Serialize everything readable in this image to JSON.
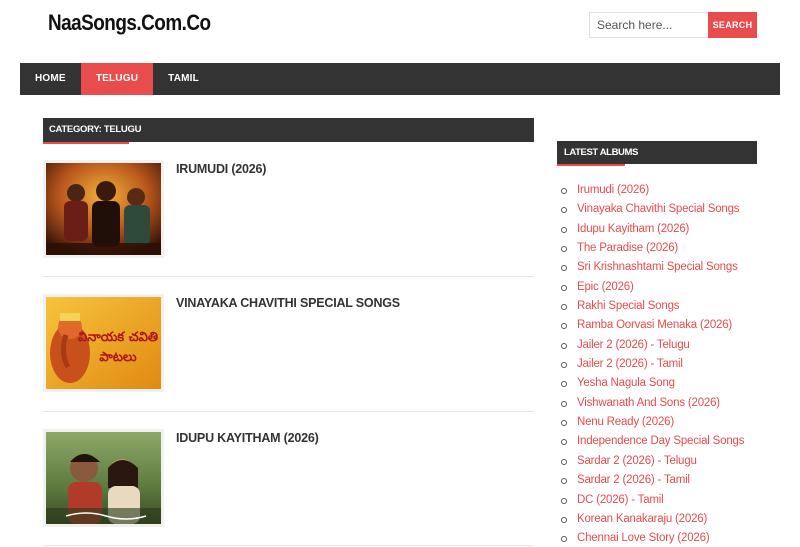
{
  "site": {
    "title": "NaaSongs.Com.Co"
  },
  "search": {
    "placeholder": "Search here...",
    "button_label": "SEARCH"
  },
  "nav": {
    "items": [
      {
        "label": "HOME",
        "active": false
      },
      {
        "label": "TELUGU",
        "active": true
      },
      {
        "label": "TAMIL",
        "active": false
      }
    ]
  },
  "category": {
    "header": "CATEGORY: TELUGU"
  },
  "posts": [
    {
      "title": "IRUMUDI (2026)",
      "thumb": "irumudi-poster"
    },
    {
      "title": "VINAYAKA CHAVITHI SPECIAL SONGS",
      "thumb": "ganesha-poster",
      "thumb_text_line1": "వినాయక చవితి",
      "thumb_text_line2": "పాటలు"
    },
    {
      "title": "IDUPU KAYITHAM (2026)",
      "thumb": "idupu-kayitham-poster"
    }
  ],
  "sidebar": {
    "header": "LATEST ALBUMS",
    "albums": [
      "Irumudi (2026)",
      "Vinayaka Chavithi Special Songs",
      "Idupu Kayitham (2026)",
      "The Paradise (2026)",
      "Sri Krishnashtami Special Songs",
      "Epic (2026)",
      "Rakhi Special Songs",
      "Ramba Oorvasi Menaka (2026)",
      "Jailer 2 (2026) - Telugu",
      "Jailer 2 (2026) - Tamil",
      "Yesha Nagula Song",
      "Vishwanath And Sons (2026)",
      "Nenu Ready (2026)",
      "Independence Day Special Songs",
      "Sardar 2 (2026) - Telugu",
      "Sardar 2 (2026) - Tamil",
      "DC (2026) - Tamil",
      "Korean Kanakaraju (2026)",
      "Chennai Love Story (2026)"
    ]
  },
  "colors": {
    "accent": "#e84c4c",
    "dark": "#333333"
  }
}
